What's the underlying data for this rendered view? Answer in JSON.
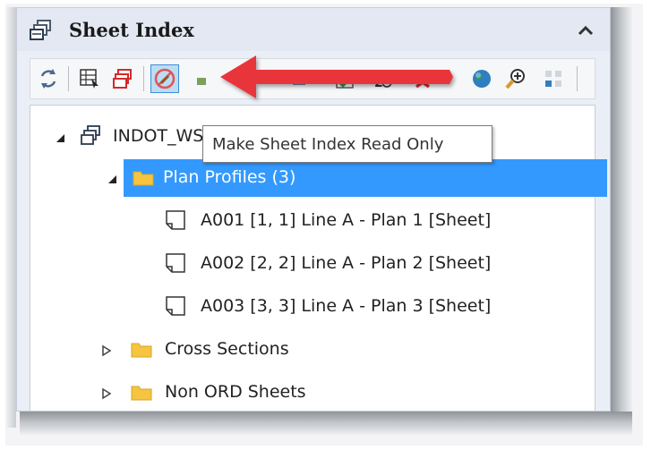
{
  "panel": {
    "title": "Sheet Index",
    "collapse_icon": "chevron-up-icon"
  },
  "toolbar": {
    "buttons": [
      {
        "icon": "refresh-icon",
        "state": "normal"
      },
      {
        "icon": "grid-select-icon",
        "state": "normal"
      },
      {
        "icon": "sheets-red-icon",
        "state": "normal"
      },
      {
        "icon": "read-only-icon",
        "state": "active"
      },
      {
        "icon": "tool-icon",
        "state": "normal"
      },
      {
        "icon": "tool-icon",
        "state": "normal"
      },
      {
        "icon": "checkmark-icon",
        "state": "normal"
      },
      {
        "icon": "renumber-icon",
        "state": "normal"
      },
      {
        "icon": "delete-icon",
        "state": "normal"
      },
      {
        "icon": "globe-icon",
        "state": "normal"
      },
      {
        "icon": "zoom-in-icon",
        "state": "normal"
      },
      {
        "icon": "tiles-icon",
        "state": "normal"
      }
    ]
  },
  "tooltip": {
    "text": "Make Sheet Index Read Only"
  },
  "tree": {
    "root": {
      "label": "INDOT_WS (2)",
      "expanded": true
    },
    "folders": [
      {
        "label": "Plan Profiles (3)",
        "expanded": true,
        "selected": true,
        "sheets": [
          "A001 [1, 1] Line A - Plan 1 [Sheet]",
          "A002 [2, 2] Line A - Plan 2 [Sheet]",
          "A003 [3, 3] Line A - Plan 3 [Sheet]"
        ]
      },
      {
        "label": "Cross Sections",
        "expanded": false,
        "selected": false
      },
      {
        "label": "Non ORD Sheets",
        "expanded": false,
        "selected": false
      }
    ]
  },
  "annotation": {
    "arrow_color": "#e8363b"
  },
  "colors": {
    "selection": "#3399ff",
    "folder": "#f5c542",
    "active_button": "#bcdcf4"
  }
}
